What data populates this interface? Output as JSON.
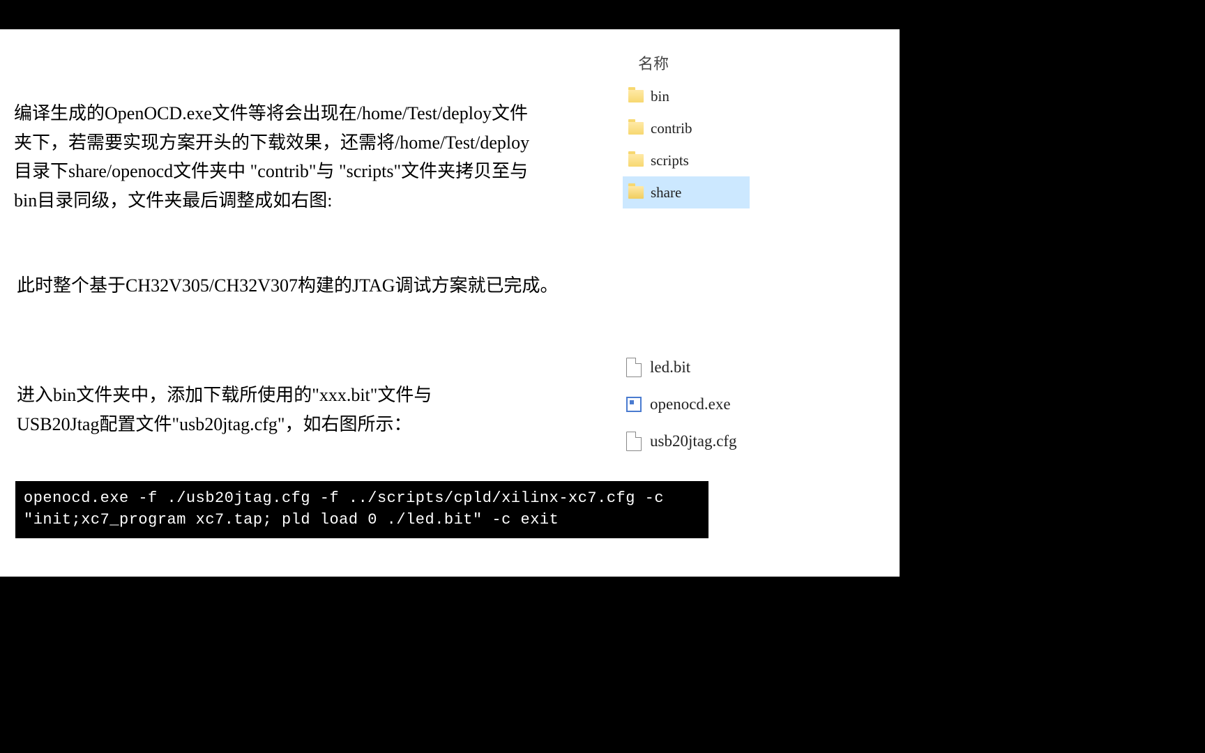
{
  "paragraphs": {
    "p1": "编译生成的OpenOCD.exe文件等将会出现在/home/Test/deploy文件夹下，若需要实现方案开头的下载效果，还需将/home/Test/deploy目录下share/openocd文件夹中 \"contrib\"与 \"scripts\"文件夹拷贝至与bin目录同级，文件夹最后调整成如右图:",
    "p2": "此时整个基于CH32V305/CH32V307构建的JTAG调试方案就已完成。",
    "p3": "进入bin文件夹中，添加下载所使用的\"xxx.bit\"文件与USB20Jtag配置文件\"usb20jtag.cfg\"，如右图所示："
  },
  "explorer": {
    "header": "名称",
    "folders": [
      {
        "name": "bin",
        "selected": false
      },
      {
        "name": "contrib",
        "selected": false
      },
      {
        "name": "scripts",
        "selected": false
      },
      {
        "name": "share",
        "selected": true
      }
    ],
    "files": [
      {
        "name": "led.bit",
        "type": "file"
      },
      {
        "name": "openocd.exe",
        "type": "exe"
      },
      {
        "name": "usb20jtag.cfg",
        "type": "file"
      }
    ]
  },
  "command": "openocd.exe -f ./usb20jtag.cfg -f ../scripts/cpld/xilinx-xc7.cfg -c \"init;xc7_program xc7.tap; pld load 0 ./led.bit\" -c exit"
}
